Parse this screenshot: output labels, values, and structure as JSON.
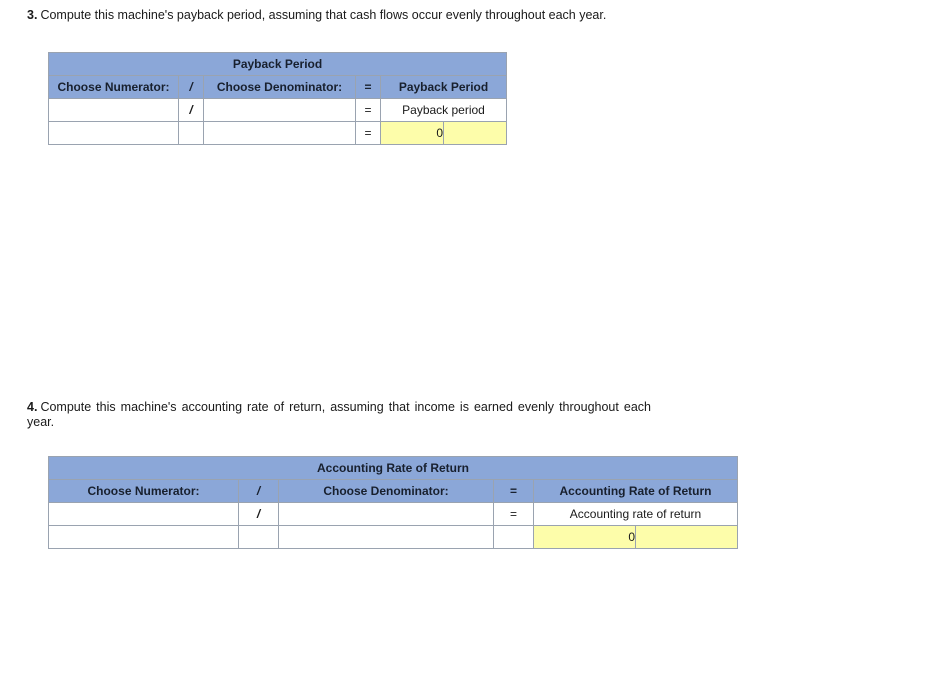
{
  "questions": [
    {
      "number": "3.",
      "text": "Compute this machine's payback period, assuming that cash flows occur evenly throughout each year."
    },
    {
      "number": "4.",
      "text": "Compute this machine's accounting rate of return, assuming that income is earned evenly throughout each year."
    }
  ],
  "colors": {
    "header_blue": "#8ba7d8",
    "input_border_yellow": "#ffff00",
    "result_fill_yellow": "#fdfdaa",
    "grid_gray": "#9aa3b0"
  },
  "table_payback": {
    "title": "Payback Period",
    "headers": {
      "numerator": "Choose Numerator:",
      "divider": "/",
      "denominator": "Choose Denominator:",
      "equals": "=",
      "result": "Payback Period"
    },
    "rows": [
      {
        "numerator": "",
        "divider": "/",
        "denominator": "",
        "equals": "=",
        "result_label": "Payback period",
        "result_value": null,
        "result_extra": null
      },
      {
        "numerator": "",
        "divider": "",
        "denominator": "",
        "equals": "=",
        "result_label": null,
        "result_value": "0",
        "result_extra": ""
      }
    ]
  },
  "table_arr": {
    "title": "Accounting Rate of Return",
    "headers": {
      "numerator": "Choose Numerator:",
      "divider": "/",
      "denominator": "Choose Denominator:",
      "equals": "=",
      "result": "Accounting Rate of Return"
    },
    "rows": [
      {
        "numerator": "",
        "divider": "/",
        "denominator": "",
        "equals": "=",
        "result_label": "Accounting rate of return",
        "result_value": null,
        "result_extra": null
      },
      {
        "numerator": "",
        "divider": "",
        "denominator": "",
        "equals": "",
        "result_label": null,
        "result_value": "0",
        "result_extra": ""
      }
    ]
  }
}
